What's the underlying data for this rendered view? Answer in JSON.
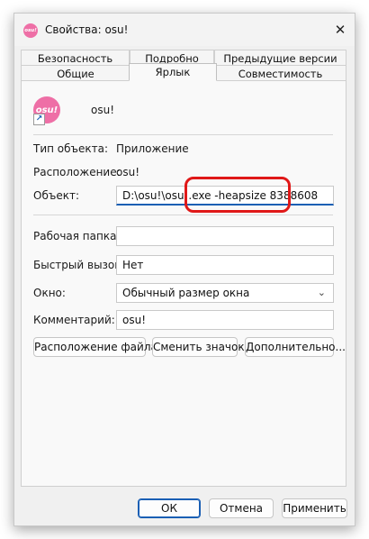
{
  "window": {
    "title": "Свойства: osu!",
    "icon_text": "osu!",
    "close_glyph": "✕"
  },
  "tabs": {
    "row1": [
      "Безопасность",
      "Подробно",
      "Предыдущие версии"
    ],
    "row2": [
      "Общие",
      "Ярлык",
      "Совместимость"
    ],
    "active": "Ярлык"
  },
  "header": {
    "icon_text": "osu!",
    "arrow_glyph": "↗",
    "name": "osu!"
  },
  "fields": {
    "type_label": "Тип объекта:",
    "type_value": "Приложение",
    "location_label": "Расположение:",
    "location_value": "osu!",
    "target_label": "Объект:",
    "target_value": "D:\\osu!\\osu!.exe -heapsize 8388608",
    "workdir_label": "Рабочая папка:",
    "workdir_value": "",
    "hotkey_label": "Быстрый вызов:",
    "hotkey_value": "Нет",
    "window_label": "Окно:",
    "window_value": "Обычный размер окна",
    "window_arrow": "⌄",
    "comment_label": "Комментарий:",
    "comment_value": "osu!"
  },
  "actions": {
    "file_location": "Расположение файла",
    "change_icon": "Сменить значок...",
    "advanced": "Дополнительно..."
  },
  "footer": {
    "ok": "ОК",
    "cancel": "Отмена",
    "apply": "Применить"
  },
  "colors": {
    "accent": "#1a5fb4",
    "highlight": "#e01818",
    "osu_pink": "#ee6fa6"
  }
}
